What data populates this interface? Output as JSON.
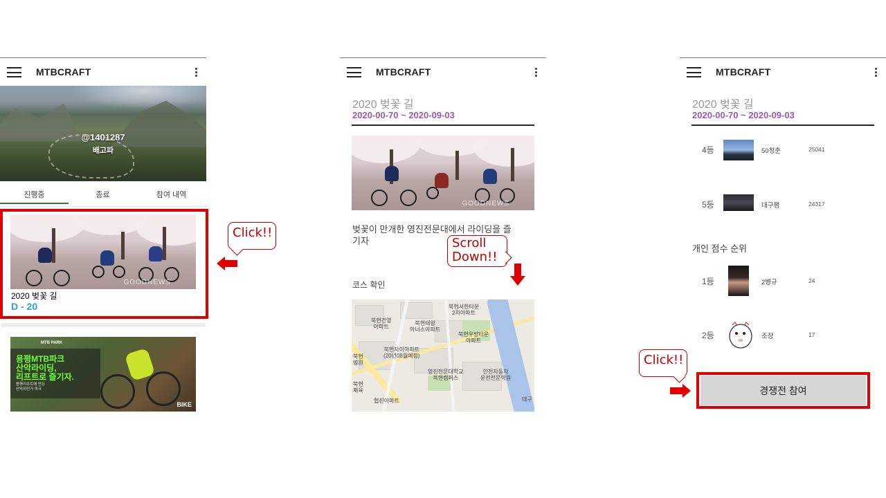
{
  "app_title": "MTBCRAFT",
  "panel1": {
    "profile": {
      "handle": "@1401287",
      "name": "배고파"
    },
    "tabs": [
      {
        "label": "진행중",
        "active": true
      },
      {
        "label": "종료",
        "active": false
      },
      {
        "label": "참여 내역",
        "active": false
      }
    ],
    "event_card": {
      "title": "2020 벚꽃 길",
      "dday": "D - 20",
      "photo_watermark": "GOODNEWS"
    },
    "ad": {
      "tag": "MTB PARK",
      "headline_lines": [
        "용평MTB파크",
        "산악라이딩,",
        "리프트로 즐기자."
      ],
      "sub_lines": [
        "용평리조트에 만든",
        "산악자전거 파크"
      ],
      "logo": "BIKE"
    }
  },
  "panel2": {
    "event_title": "2020 벚꽃 길",
    "event_dates": "2020-00-70 ~ 2020-09-03",
    "description": "벚꽃이 만개한 영진전문대에서 라이딩을 즐기자",
    "course_label": "코스 확인",
    "photo_watermark": "GOODNEWS",
    "map_labels": [
      "북현서한타운 2차아파트",
      "북현건영 아파트",
      "북현태왕 아너스아파트",
      "북현우방타운 아파트",
      "북현자이아파트 (20년08월예정)",
      "영진전문대학교 복현캠퍼스",
      "안전자동차 운전전문학원",
      "북현 병원",
      "북현 체육",
      "협진아파트",
      "대구"
    ]
  },
  "panel3": {
    "event_title": "2020 벚꽃 길",
    "event_dates": "2020-00-70 ~ 2020-09-03",
    "team_ranks": [
      {
        "rank": "4등",
        "name": "50청춘",
        "score": "25041"
      },
      {
        "rank": "5등",
        "name": "대구팸",
        "score": "24317"
      }
    ],
    "individual_title": "개인 점수 순위",
    "individual_ranks": [
      {
        "rank": "1등",
        "name": "2병규",
        "score": "24"
      },
      {
        "rank": "2등",
        "name": "조장",
        "score": "17"
      }
    ],
    "join_button": "경쟁전 참여"
  },
  "annotations": {
    "click1": "Click!!",
    "scroll": [
      "Scroll",
      "Down!!"
    ],
    "click2": "Click!!"
  },
  "colors": {
    "accent_red": "#e00000",
    "date_purple": "#9b59b6",
    "dday_blue": "#29a3d3",
    "tab_green": "#2e7d32"
  }
}
